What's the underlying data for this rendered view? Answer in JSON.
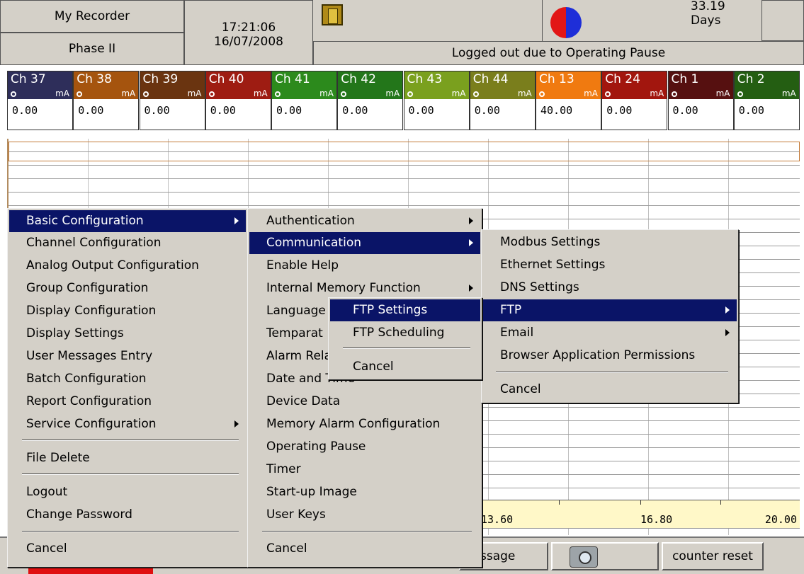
{
  "header": {
    "recorder_name": "My Recorder",
    "phase": "Phase II",
    "time": "17:21:06",
    "date": "16/07/2008",
    "days": "33.19 Days",
    "status": "Logged out due to Operating Pause"
  },
  "channels": [
    {
      "name": "Ch 37",
      "unit": "mA",
      "value": "0.00",
      "color": "#2e2e5a"
    },
    {
      "name": "Ch 38",
      "unit": "mA",
      "value": "0.00",
      "color": "#a5540e"
    },
    {
      "name": "Ch 39",
      "unit": "mA",
      "value": "0.00",
      "color": "#6a3410"
    },
    {
      "name": "Ch 40",
      "unit": "mA",
      "value": "0.00",
      "color": "#9e1c12"
    },
    {
      "name": "Ch 41",
      "unit": "mA",
      "value": "0.00",
      "color": "#2c8a1c"
    },
    {
      "name": "Ch 42",
      "unit": "mA",
      "value": "0.00",
      "color": "#23761a"
    },
    {
      "name": "Ch 43",
      "unit": "mA",
      "value": "0.00",
      "color": "#7aa01e"
    },
    {
      "name": "Ch 44",
      "unit": "mA",
      "value": "0.00",
      "color": "#7a7e1c"
    },
    {
      "name": "Ch 13",
      "unit": "mA",
      "value": "40.00",
      "color": "#f07a10"
    },
    {
      "name": "Ch 24",
      "unit": "mA",
      "value": "0.00",
      "color": "#a2160e"
    },
    {
      "name": "Ch 1",
      "unit": "mA",
      "value": "0.00",
      "color": "#561010"
    },
    {
      "name": "Ch 2",
      "unit": "mA",
      "value": "0.00",
      "color": "#245e12"
    }
  ],
  "scale": {
    "left": "13.60",
    "mid": "16.80",
    "right": "20.00"
  },
  "bottom": {
    "message_fragment": "ssage",
    "counter_reset": "counter reset"
  },
  "menu_main": {
    "items": [
      "Basic Configuration",
      "Channel Configuration",
      "Analog Output Configuration",
      "Group Configuration",
      "Display Configuration",
      "Display Settings",
      "User Messages Entry",
      "Batch Configuration",
      "Report Configuration",
      "Service Configuration",
      "File Delete",
      "Logout",
      "Change Password",
      "Cancel"
    ]
  },
  "menu_basic": {
    "items": [
      "Authentication",
      "Communication",
      "Enable Help",
      "Internal Memory Function",
      "Language",
      "Temparat",
      "Alarm Rela",
      "Date and Time",
      "Device Data",
      "Memory Alarm Configuration",
      "Operating Pause",
      "Timer",
      "Start-up Image",
      "User Keys",
      "Cancel"
    ]
  },
  "menu_comm": {
    "items": [
      "Modbus Settings",
      "Ethernet Settings",
      "DNS Settings",
      "FTP",
      "Email",
      "Browser Application Permissions",
      "Cancel"
    ]
  },
  "menu_ftp": {
    "items": [
      "FTP Settings",
      "FTP Scheduling",
      "Cancel"
    ]
  }
}
